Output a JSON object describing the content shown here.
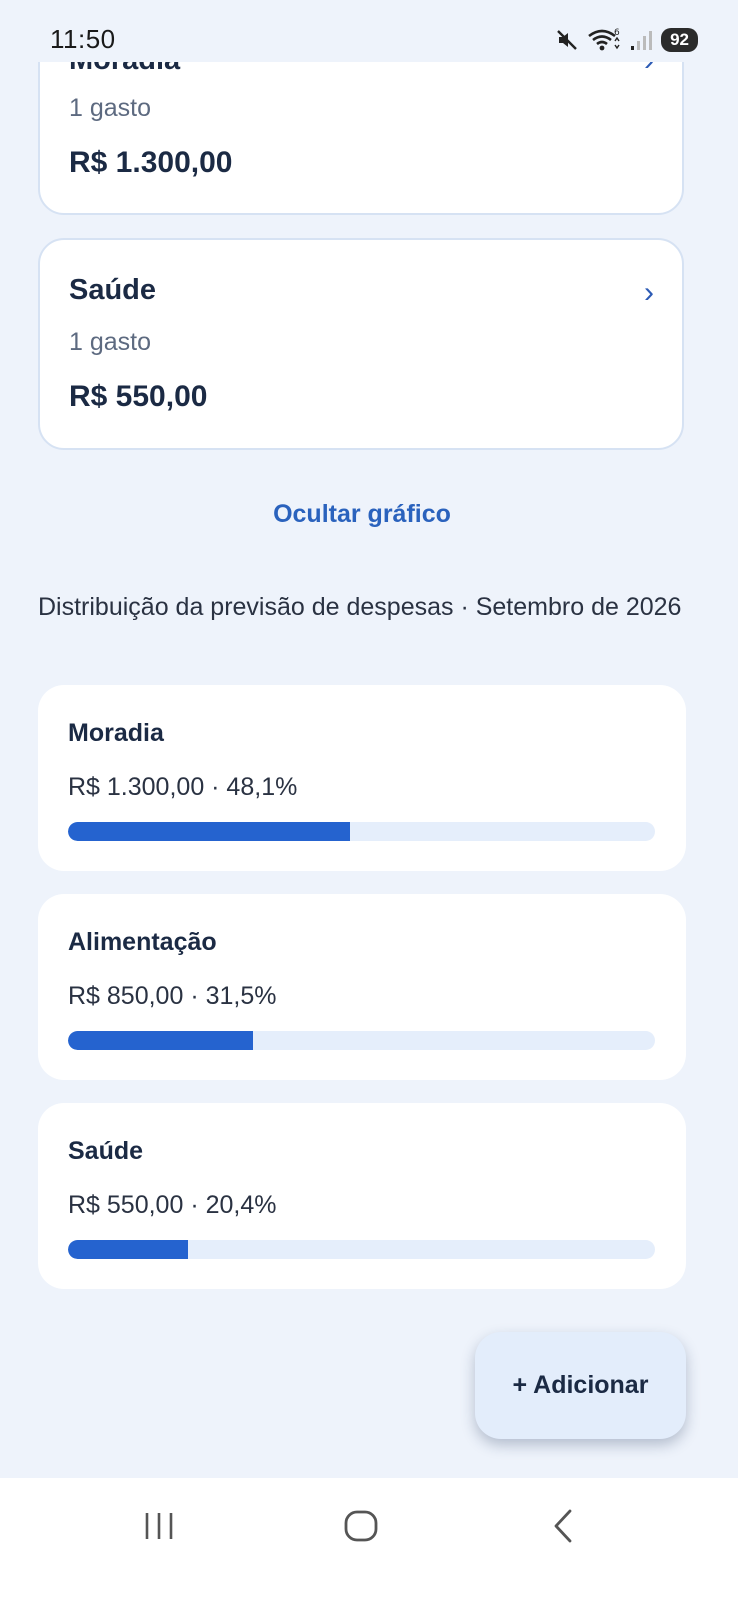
{
  "status_bar": {
    "time": "11:50",
    "battery": "92",
    "icons": [
      "mute-icon",
      "wifi-icon",
      "signal-icon",
      "battery-icon"
    ]
  },
  "category_cards": [
    {
      "name": "Moradia",
      "count": "1 gasto",
      "total": "R$ 1.300,00"
    },
    {
      "name": "Saúde",
      "count": "1 gasto",
      "total": "R$ 550,00"
    }
  ],
  "toggle_chart_label": "Ocultar gráfico",
  "distribution": {
    "title": "Distribuição da previsão de despesas · Setembro de 2026",
    "items": [
      {
        "name": "Moradia",
        "value_text": "R$ 1.300,00 · 48,1%",
        "percent": 48.1
      },
      {
        "name": "Alimentação",
        "value_text": "R$ 850,00 · 31,5%",
        "percent": 31.5
      },
      {
        "name": "Saúde",
        "value_text": "R$ 550,00 · 20,4%",
        "percent": 20.4
      }
    ]
  },
  "fab": {
    "label": "+ Adicionar"
  },
  "nav_bar": {
    "buttons": [
      "recents-icon",
      "home-icon",
      "back-icon"
    ]
  },
  "colors": {
    "accent": "#2563cf",
    "link": "#2a62bd",
    "background": "#eef3fb",
    "card": "#ffffff",
    "track": "#e5eefb"
  }
}
